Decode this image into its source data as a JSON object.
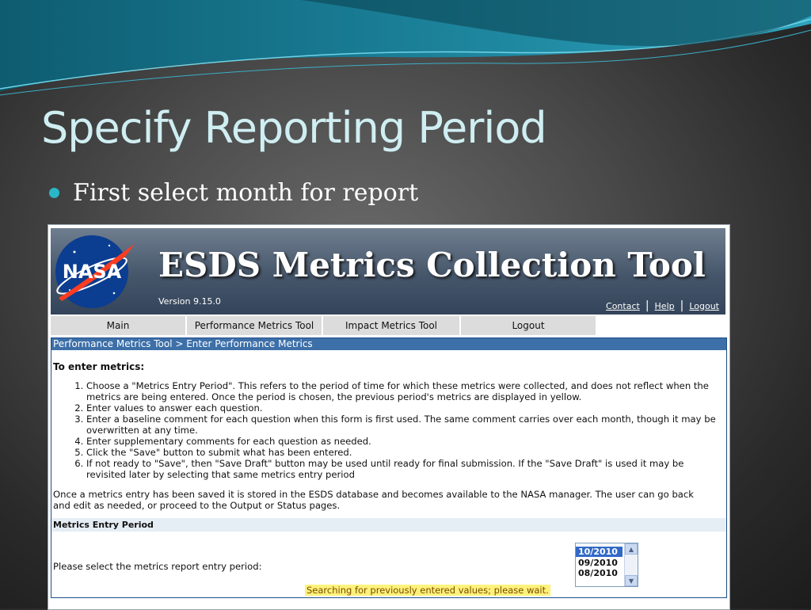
{
  "slide": {
    "title": "Specify Reporting Period",
    "bullet": "First select month for report"
  },
  "app": {
    "logo_text": "NASA",
    "title": "ESDS Metrics Collection Tool",
    "version": "Version 9.15.0",
    "links": {
      "contact": "Contact",
      "help": "Help",
      "logout": "Logout"
    }
  },
  "nav": [
    {
      "label": "Main"
    },
    {
      "label": "Performance Metrics Tool"
    },
    {
      "label": "Impact Metrics Tool"
    },
    {
      "label": "Logout"
    }
  ],
  "breadcrumb": "Performance Metrics Tool > Enter Performance Metrics",
  "instructions": {
    "heading": "To enter metrics:",
    "steps": [
      "Choose a \"Metrics Entry Period\". This refers to the period of time for which these metrics were collected, and does not reflect when the metrics are being entered. Once the period is chosen, the previous period's metrics are displayed in yellow.",
      "Enter values to answer each question.",
      "Enter a baseline comment for each question when this form is first used. The same comment carries over each month, though it may be overwritten at any time.",
      "Enter supplementary comments for each question as needed.",
      "Click the \"Save\" button to submit what has been entered.",
      "If not ready to \"Save\", then \"Save Draft\" button may be used until ready for final submission. If the \"Save Draft\" is used it may be revisited later by selecting that same metrics entry period"
    ],
    "note": "Once a metrics entry has been saved it is stored in the ESDS database and becomes available to the NASA manager. The user can go back and edit as needed, or proceed to the Output or Status pages."
  },
  "period": {
    "section_title": "Metrics Entry Period",
    "label": "Please select the metrics report entry period:",
    "options": [
      "10/2010",
      "09/2010",
      "08/2010"
    ],
    "selected": "10/2010",
    "status": "Searching for previously entered values; please wait."
  },
  "colors": {
    "title": "#cfeef2",
    "bullet": "#29b6c8",
    "breadcrumb_bg": "#3d6fa8",
    "selected_option": "#3169c6",
    "status_bg": "#fff27a"
  }
}
